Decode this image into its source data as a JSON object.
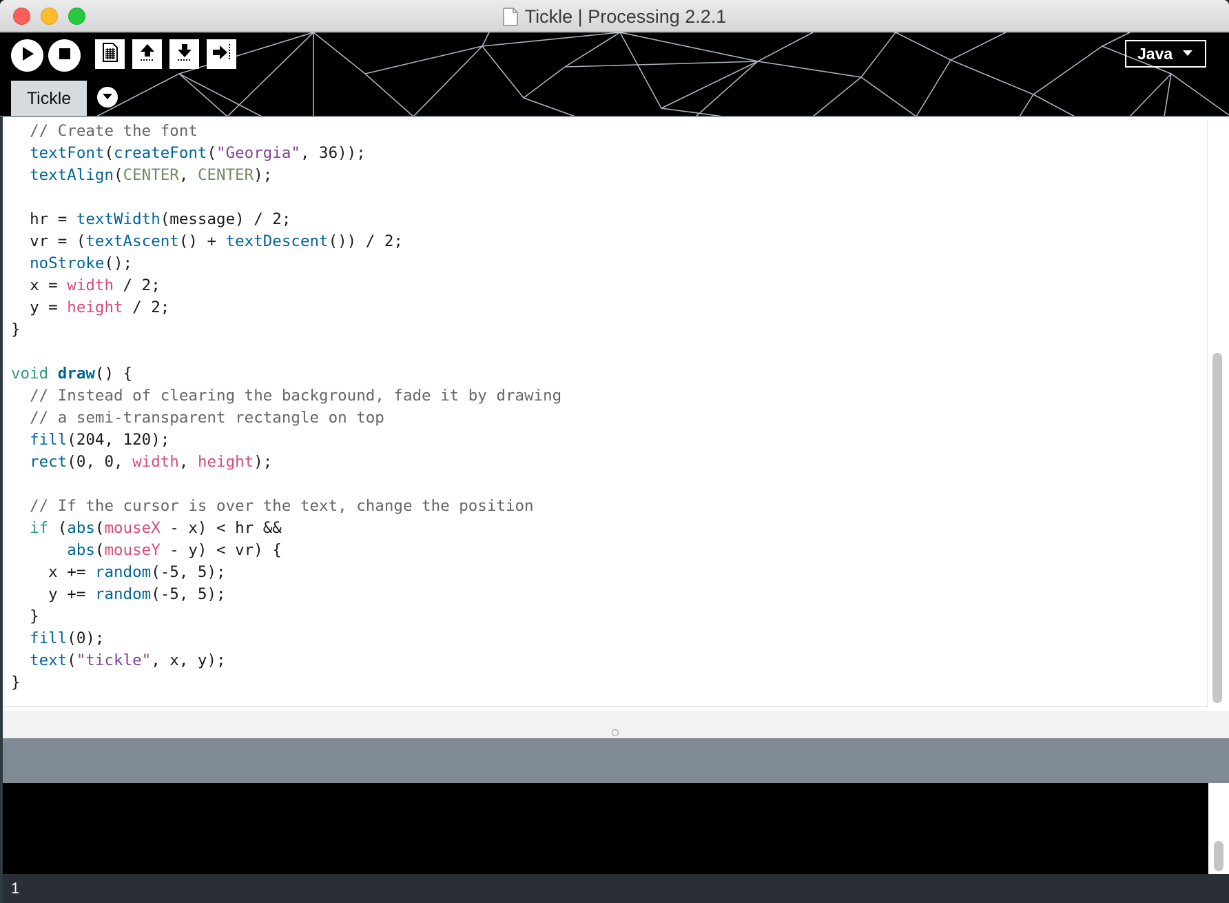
{
  "window": {
    "title": "Tickle | Processing 2.2.1"
  },
  "toolbar": {
    "buttons": [
      {
        "name": "run",
        "icon": "play-icon"
      },
      {
        "name": "stop",
        "icon": "stop-icon"
      },
      {
        "name": "new",
        "icon": "new-sketch-icon"
      },
      {
        "name": "open",
        "icon": "open-arrow-up-icon"
      },
      {
        "name": "save",
        "icon": "save-arrow-down-icon"
      },
      {
        "name": "export",
        "icon": "export-arrow-right-icon"
      }
    ],
    "mode": {
      "label": "Java",
      "icon": "chevron-down-icon"
    }
  },
  "tabs": [
    {
      "label": "Tickle",
      "active": true
    }
  ],
  "editor": {
    "lines": [
      [
        {
          "t": "  "
        },
        {
          "t": "// Create the font",
          "c": "com"
        }
      ],
      [
        {
          "t": "  "
        },
        {
          "t": "textFont",
          "c": "fn"
        },
        {
          "t": "("
        },
        {
          "t": "createFont",
          "c": "fn"
        },
        {
          "t": "("
        },
        {
          "t": "\"Georgia\"",
          "c": "str"
        },
        {
          "t": ", 36));"
        }
      ],
      [
        {
          "t": "  "
        },
        {
          "t": "textAlign",
          "c": "fn"
        },
        {
          "t": "("
        },
        {
          "t": "CENTER",
          "c": "const"
        },
        {
          "t": ", "
        },
        {
          "t": "CENTER",
          "c": "const"
        },
        {
          "t": ");"
        }
      ],
      [
        {
          "t": ""
        }
      ],
      [
        {
          "t": "  hr = "
        },
        {
          "t": "textWidth",
          "c": "fn"
        },
        {
          "t": "(message) / 2;"
        }
      ],
      [
        {
          "t": "  vr = ("
        },
        {
          "t": "textAscent",
          "c": "fn"
        },
        {
          "t": "() + "
        },
        {
          "t": "textDescent",
          "c": "fn"
        },
        {
          "t": "()) / 2;"
        }
      ],
      [
        {
          "t": "  "
        },
        {
          "t": "noStroke",
          "c": "fn"
        },
        {
          "t": "();"
        }
      ],
      [
        {
          "t": "  x = "
        },
        {
          "t": "width",
          "c": "var"
        },
        {
          "t": " / 2;"
        }
      ],
      [
        {
          "t": "  y = "
        },
        {
          "t": "height",
          "c": "var"
        },
        {
          "t": " / 2;"
        }
      ],
      [
        {
          "t": "}"
        }
      ],
      [
        {
          "t": ""
        }
      ],
      [
        {
          "t": "void",
          "c": "kw"
        },
        {
          "t": " "
        },
        {
          "t": "draw",
          "c": "drawkw"
        },
        {
          "t": "() {"
        }
      ],
      [
        {
          "t": "  "
        },
        {
          "t": "// Instead of clearing the background, fade it by drawing",
          "c": "com"
        }
      ],
      [
        {
          "t": "  "
        },
        {
          "t": "// a semi-transparent rectangle on top",
          "c": "com"
        }
      ],
      [
        {
          "t": "  "
        },
        {
          "t": "fill",
          "c": "fn"
        },
        {
          "t": "(204, 120);"
        }
      ],
      [
        {
          "t": "  "
        },
        {
          "t": "rect",
          "c": "fn"
        },
        {
          "t": "(0, 0, "
        },
        {
          "t": "width",
          "c": "var"
        },
        {
          "t": ", "
        },
        {
          "t": "height",
          "c": "var"
        },
        {
          "t": ");"
        }
      ],
      [
        {
          "t": ""
        }
      ],
      [
        {
          "t": "  "
        },
        {
          "t": "// If the cursor is over the text, change the position",
          "c": "com"
        }
      ],
      [
        {
          "t": "  "
        },
        {
          "t": "if",
          "c": "kw"
        },
        {
          "t": " ("
        },
        {
          "t": "abs",
          "c": "fn"
        },
        {
          "t": "("
        },
        {
          "t": "mouseX",
          "c": "var"
        },
        {
          "t": " - x) < hr &&"
        }
      ],
      [
        {
          "t": "      "
        },
        {
          "t": "abs",
          "c": "fn"
        },
        {
          "t": "("
        },
        {
          "t": "mouseY",
          "c": "var"
        },
        {
          "t": " - y) < vr) {"
        }
      ],
      [
        {
          "t": "    x += "
        },
        {
          "t": "random",
          "c": "fn"
        },
        {
          "t": "(-5, 5);"
        }
      ],
      [
        {
          "t": "    y += "
        },
        {
          "t": "random",
          "c": "fn"
        },
        {
          "t": "(-5, 5);"
        }
      ],
      [
        {
          "t": "  }"
        }
      ],
      [
        {
          "t": "  "
        },
        {
          "t": "fill",
          "c": "fn"
        },
        {
          "t": "(0);"
        }
      ],
      [
        {
          "t": "  "
        },
        {
          "t": "text",
          "c": "fn"
        },
        {
          "t": "("
        },
        {
          "t": "\"tickle\"",
          "c": "str"
        },
        {
          "t": ", x, y);"
        }
      ],
      [
        {
          "t": "}"
        }
      ]
    ]
  },
  "footer": {
    "line_number": "1"
  },
  "colors": {
    "comment": "#666666",
    "function": "#006699",
    "keyword": "#33997e",
    "variable": "#d94a7a",
    "string": "#7d4793",
    "constant": "#718a62",
    "status_bar": "#808a94"
  }
}
